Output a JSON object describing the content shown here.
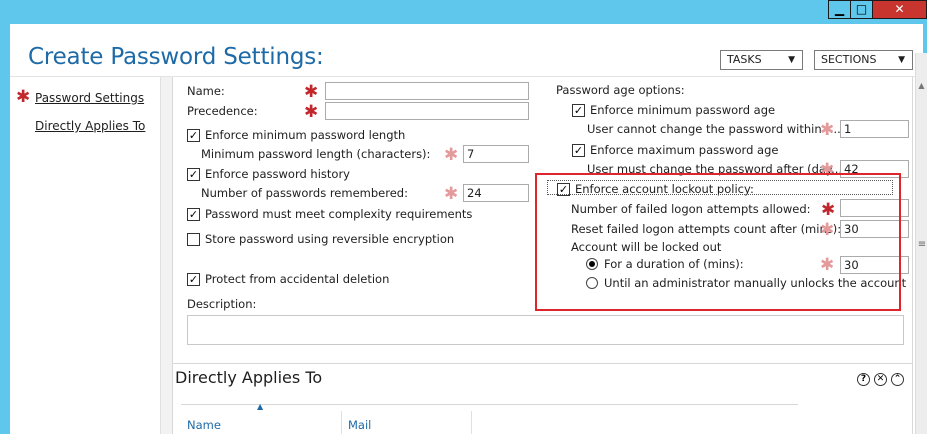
{
  "window": {
    "minimize_glyph": "▁",
    "restore_glyph": "□",
    "close_glyph": "✕"
  },
  "header": {
    "title": "Create Password Settings:",
    "tasks_label": "TASKS",
    "sections_label": "SECTIONS",
    "dropdown_glyph": "▼"
  },
  "nav": {
    "items": [
      {
        "label": "Password Settings",
        "required": true
      },
      {
        "label": "Directly Applies To",
        "required": false
      }
    ]
  },
  "form": {
    "required_glyph": "✱",
    "check_glyph": "✓",
    "name_label": "Name:",
    "name_value": "",
    "precedence_label": "Precedence:",
    "precedence_value": "",
    "enforce_min_length_label": "Enforce minimum password length",
    "enforce_min_length_checked": true,
    "min_length_label": "Minimum password length (characters):",
    "min_length_value": "7",
    "enforce_history_label": "Enforce password history",
    "enforce_history_checked": true,
    "history_label": "Number of passwords remembered:",
    "history_value": "24",
    "complexity_label": "Password must meet complexity requirements",
    "complexity_checked": true,
    "reversible_label": "Store password using reversible encryption",
    "reversible_checked": false,
    "protect_label": "Protect from accidental deletion",
    "protect_checked": true,
    "description_label": "Description:",
    "description_value": "",
    "age_options_label": "Password age options:",
    "enforce_min_age_label": "Enforce minimum password age",
    "enforce_min_age_checked": true,
    "min_age_label": "User cannot change the password within (...",
    "min_age_value": "1",
    "enforce_max_age_label": "Enforce maximum password age",
    "enforce_max_age_checked": true,
    "max_age_label": "User must change the password after (day...",
    "max_age_value": "42",
    "lockout_label": "Enforce account lockout policy:",
    "lockout_checked": true,
    "failed_attempts_label": "Number of failed logon attempts allowed:",
    "failed_attempts_value": "",
    "reset_label": "Reset failed logon attempts count after (mins):",
    "reset_value": "30",
    "locked_out_label": "Account will be locked out",
    "duration_label": "For a duration of (mins):",
    "duration_selected": true,
    "duration_value": "30",
    "admin_unlock_label": "Until an administrator manually unlocks the account",
    "admin_unlock_selected": false
  },
  "applies_to": {
    "title": "Directly Applies To",
    "help_glyph": "?",
    "close_glyph": "✕",
    "collapse_glyph": "⌃",
    "columns": [
      "Name",
      "Mail"
    ],
    "sort_glyph": "▲"
  },
  "scrollbar": {
    "up_glyph": "▲",
    "grip_glyph": "≡"
  },
  "colors": {
    "titlebar": "#5fc6ec",
    "title_text": "#1e6aa7",
    "required": "#c1272d",
    "highlight": "#e0242c",
    "close_button": "#c8352f"
  }
}
